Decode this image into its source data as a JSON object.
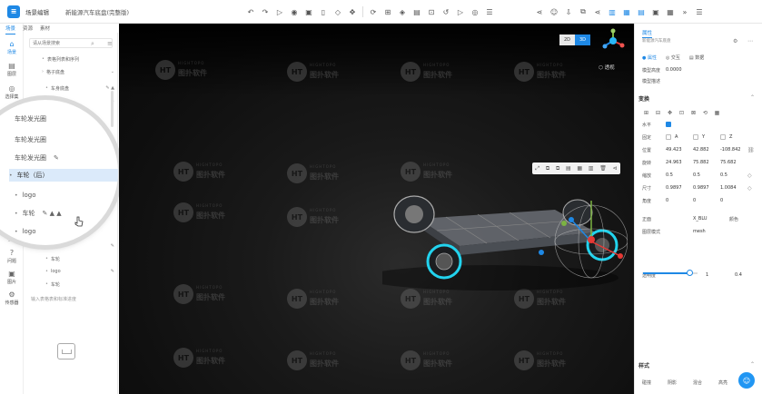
{
  "header": {
    "app_title": "场景编辑",
    "doc_title": "新能源汽车底盘(完整版)",
    "tool_icons": [
      "undo-icon",
      "redo-icon",
      "play-icon",
      "camera-icon",
      "save-icon",
      "file-icon",
      "shape-icon",
      "move-icon",
      "rotate-icon",
      "grid-icon",
      "layer-icon",
      "stack-icon",
      "measure-icon",
      "refresh-icon",
      "play-outline-icon",
      "record-icon",
      "list-icon"
    ],
    "right_icons": [
      "share-icon",
      "user-icon",
      "download-icon",
      "copy-icon",
      "share2-icon",
      "layout-a-icon",
      "layout-b-icon",
      "layout-c-icon",
      "layout-d-icon",
      "layout-e-icon",
      "more-icon",
      "menu-icon"
    ]
  },
  "left": {
    "tabs": [
      {
        "label": "场景"
      },
      {
        "label": "资源"
      },
      {
        "label": "素材"
      }
    ],
    "rail": [
      {
        "label": "场景",
        "icon": "⌂"
      },
      {
        "label": "图层",
        "icon": "▤"
      },
      {
        "label": "选择集",
        "icon": "◎"
      },
      {
        "label": "材质",
        "icon": "▧"
      },
      {
        "label": "学习",
        "icon": "✎"
      },
      {
        "label": "问题",
        "icon": "?"
      },
      {
        "label": "图片",
        "icon": "▣"
      },
      {
        "label": "传感器",
        "icon": "⚙"
      }
    ],
    "search_placeholder": "请从场景搜索",
    "tree": [
      {
        "label": "表格列表和序列",
        "ic": ""
      },
      {
        "label": "格子底盘",
        "ic": "⌄"
      },
      {
        "label": "车身底盘",
        "ic": "✎ ▲"
      },
      {
        "label": "车辆底盘",
        "ic": "✎"
      },
      {
        "label": "车轮(后)",
        "ic": ""
      },
      {
        "label": "车轮",
        "ic": ""
      },
      {
        "label": "logo",
        "ic": ""
      },
      {
        "label": "logo",
        "ic": ""
      },
      {
        "label": "车轮",
        "ic": "✎"
      },
      {
        "label": "车轮",
        "ic": ""
      },
      {
        "label": "logo",
        "ic": "✎"
      },
      {
        "label": "车轮",
        "ic": ""
      }
    ],
    "add_text": "输入表格表和标准进度",
    "magnified": [
      {
        "label": "车轮发光圈",
        "ic": ""
      },
      {
        "label": "车轮发光圈",
        "ic": ""
      },
      {
        "label": "车轮发光圈",
        "ic": "✎"
      },
      {
        "label": "车轮（后）",
        "ic": ""
      },
      {
        "label": "logo",
        "ic": ""
      },
      {
        "label": "车轮",
        "ic": "✎ ▲ ▲"
      },
      {
        "label": "logo",
        "ic": ""
      }
    ]
  },
  "viewport": {
    "btn_2d": "2D",
    "btn_3d": "3D",
    "perspective": "透视",
    "watermark_cn": "图扑软件",
    "watermark_en": "HIGHTOPO",
    "watermark_logo": "HT",
    "float_tools": [
      "⤢",
      "⧉",
      "⧉",
      "▤",
      "▦",
      "▥",
      "🗑",
      "⊲"
    ]
  },
  "props": {
    "header": "属性",
    "name_placeholder": "新能源汽车底盘",
    "tabs": [
      {
        "label": "● 属性"
      },
      {
        "label": "◎ 交互"
      },
      {
        "label": "▤ 数据"
      }
    ],
    "type_label": "模型高度",
    "type_value": "0.0000",
    "desc_label": "模型描述",
    "transform_section": "变换",
    "align_label": "水平",
    "coord_label": "固定",
    "coord_opts": [
      "A",
      "Y",
      "Z"
    ],
    "position_label": "位置",
    "position": [
      "49.423",
      "42.882",
      "-108.842"
    ],
    "rotation_label": "旋转",
    "rotation": [
      "24.963",
      "75.882",
      "75.682"
    ],
    "scale_label": "缩放",
    "scale": [
      "0.5",
      "0.5",
      "0.5"
    ],
    "size_label": "尺寸",
    "size": [
      "0.9897",
      "0.9897",
      "1.0084"
    ],
    "anchor_label": "角度",
    "anchor": [
      "0",
      "0",
      "0"
    ],
    "face_label": "正面",
    "face_value": "X_BLU",
    "color_label": "颜色",
    "mode_label": "图层模式",
    "mode_value": "mesh",
    "opacity_label": "透明度",
    "opacity_value": "1",
    "opacity_level": 0.85,
    "size_value": "0.4",
    "style_section": "样式",
    "bottom_labels": [
      "碰撞",
      "阴影",
      "混合",
      "高亮"
    ]
  }
}
